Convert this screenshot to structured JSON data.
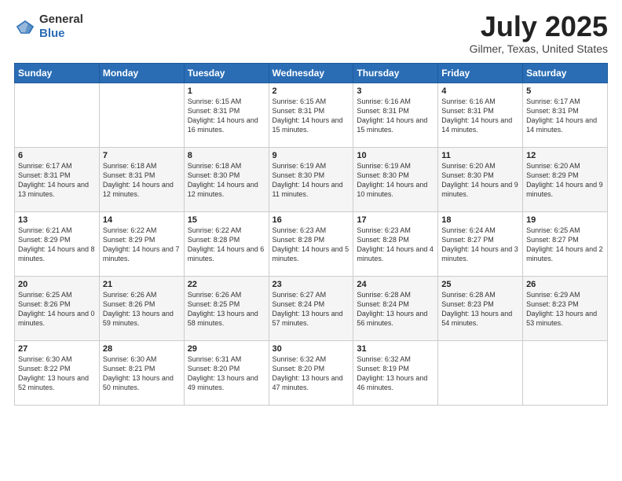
{
  "header": {
    "logo_general": "General",
    "logo_blue": "Blue",
    "month_title": "July 2025",
    "location": "Gilmer, Texas, United States"
  },
  "weekdays": [
    "Sunday",
    "Monday",
    "Tuesday",
    "Wednesday",
    "Thursday",
    "Friday",
    "Saturday"
  ],
  "weeks": [
    [
      {
        "day": "",
        "sunrise": "",
        "sunset": "",
        "daylight": ""
      },
      {
        "day": "",
        "sunrise": "",
        "sunset": "",
        "daylight": ""
      },
      {
        "day": "1",
        "sunrise": "Sunrise: 6:15 AM",
        "sunset": "Sunset: 8:31 PM",
        "daylight": "Daylight: 14 hours and 16 minutes."
      },
      {
        "day": "2",
        "sunrise": "Sunrise: 6:15 AM",
        "sunset": "Sunset: 8:31 PM",
        "daylight": "Daylight: 14 hours and 15 minutes."
      },
      {
        "day": "3",
        "sunrise": "Sunrise: 6:16 AM",
        "sunset": "Sunset: 8:31 PM",
        "daylight": "Daylight: 14 hours and 15 minutes."
      },
      {
        "day": "4",
        "sunrise": "Sunrise: 6:16 AM",
        "sunset": "Sunset: 8:31 PM",
        "daylight": "Daylight: 14 hours and 14 minutes."
      },
      {
        "day": "5",
        "sunrise": "Sunrise: 6:17 AM",
        "sunset": "Sunset: 8:31 PM",
        "daylight": "Daylight: 14 hours and 14 minutes."
      }
    ],
    [
      {
        "day": "6",
        "sunrise": "Sunrise: 6:17 AM",
        "sunset": "Sunset: 8:31 PM",
        "daylight": "Daylight: 14 hours and 13 minutes."
      },
      {
        "day": "7",
        "sunrise": "Sunrise: 6:18 AM",
        "sunset": "Sunset: 8:31 PM",
        "daylight": "Daylight: 14 hours and 12 minutes."
      },
      {
        "day": "8",
        "sunrise": "Sunrise: 6:18 AM",
        "sunset": "Sunset: 8:30 PM",
        "daylight": "Daylight: 14 hours and 12 minutes."
      },
      {
        "day": "9",
        "sunrise": "Sunrise: 6:19 AM",
        "sunset": "Sunset: 8:30 PM",
        "daylight": "Daylight: 14 hours and 11 minutes."
      },
      {
        "day": "10",
        "sunrise": "Sunrise: 6:19 AM",
        "sunset": "Sunset: 8:30 PM",
        "daylight": "Daylight: 14 hours and 10 minutes."
      },
      {
        "day": "11",
        "sunrise": "Sunrise: 6:20 AM",
        "sunset": "Sunset: 8:30 PM",
        "daylight": "Daylight: 14 hours and 9 minutes."
      },
      {
        "day": "12",
        "sunrise": "Sunrise: 6:20 AM",
        "sunset": "Sunset: 8:29 PM",
        "daylight": "Daylight: 14 hours and 9 minutes."
      }
    ],
    [
      {
        "day": "13",
        "sunrise": "Sunrise: 6:21 AM",
        "sunset": "Sunset: 8:29 PM",
        "daylight": "Daylight: 14 hours and 8 minutes."
      },
      {
        "day": "14",
        "sunrise": "Sunrise: 6:22 AM",
        "sunset": "Sunset: 8:29 PM",
        "daylight": "Daylight: 14 hours and 7 minutes."
      },
      {
        "day": "15",
        "sunrise": "Sunrise: 6:22 AM",
        "sunset": "Sunset: 8:28 PM",
        "daylight": "Daylight: 14 hours and 6 minutes."
      },
      {
        "day": "16",
        "sunrise": "Sunrise: 6:23 AM",
        "sunset": "Sunset: 8:28 PM",
        "daylight": "Daylight: 14 hours and 5 minutes."
      },
      {
        "day": "17",
        "sunrise": "Sunrise: 6:23 AM",
        "sunset": "Sunset: 8:28 PM",
        "daylight": "Daylight: 14 hours and 4 minutes."
      },
      {
        "day": "18",
        "sunrise": "Sunrise: 6:24 AM",
        "sunset": "Sunset: 8:27 PM",
        "daylight": "Daylight: 14 hours and 3 minutes."
      },
      {
        "day": "19",
        "sunrise": "Sunrise: 6:25 AM",
        "sunset": "Sunset: 8:27 PM",
        "daylight": "Daylight: 14 hours and 2 minutes."
      }
    ],
    [
      {
        "day": "20",
        "sunrise": "Sunrise: 6:25 AM",
        "sunset": "Sunset: 8:26 PM",
        "daylight": "Daylight: 14 hours and 0 minutes."
      },
      {
        "day": "21",
        "sunrise": "Sunrise: 6:26 AM",
        "sunset": "Sunset: 8:26 PM",
        "daylight": "Daylight: 13 hours and 59 minutes."
      },
      {
        "day": "22",
        "sunrise": "Sunrise: 6:26 AM",
        "sunset": "Sunset: 8:25 PM",
        "daylight": "Daylight: 13 hours and 58 minutes."
      },
      {
        "day": "23",
        "sunrise": "Sunrise: 6:27 AM",
        "sunset": "Sunset: 8:24 PM",
        "daylight": "Daylight: 13 hours and 57 minutes."
      },
      {
        "day": "24",
        "sunrise": "Sunrise: 6:28 AM",
        "sunset": "Sunset: 8:24 PM",
        "daylight": "Daylight: 13 hours and 56 minutes."
      },
      {
        "day": "25",
        "sunrise": "Sunrise: 6:28 AM",
        "sunset": "Sunset: 8:23 PM",
        "daylight": "Daylight: 13 hours and 54 minutes."
      },
      {
        "day": "26",
        "sunrise": "Sunrise: 6:29 AM",
        "sunset": "Sunset: 8:23 PM",
        "daylight": "Daylight: 13 hours and 53 minutes."
      }
    ],
    [
      {
        "day": "27",
        "sunrise": "Sunrise: 6:30 AM",
        "sunset": "Sunset: 8:22 PM",
        "daylight": "Daylight: 13 hours and 52 minutes."
      },
      {
        "day": "28",
        "sunrise": "Sunrise: 6:30 AM",
        "sunset": "Sunset: 8:21 PM",
        "daylight": "Daylight: 13 hours and 50 minutes."
      },
      {
        "day": "29",
        "sunrise": "Sunrise: 6:31 AM",
        "sunset": "Sunset: 8:20 PM",
        "daylight": "Daylight: 13 hours and 49 minutes."
      },
      {
        "day": "30",
        "sunrise": "Sunrise: 6:32 AM",
        "sunset": "Sunset: 8:20 PM",
        "daylight": "Daylight: 13 hours and 47 minutes."
      },
      {
        "day": "31",
        "sunrise": "Sunrise: 6:32 AM",
        "sunset": "Sunset: 8:19 PM",
        "daylight": "Daylight: 13 hours and 46 minutes."
      },
      {
        "day": "",
        "sunrise": "",
        "sunset": "",
        "daylight": ""
      },
      {
        "day": "",
        "sunrise": "",
        "sunset": "",
        "daylight": ""
      }
    ]
  ]
}
